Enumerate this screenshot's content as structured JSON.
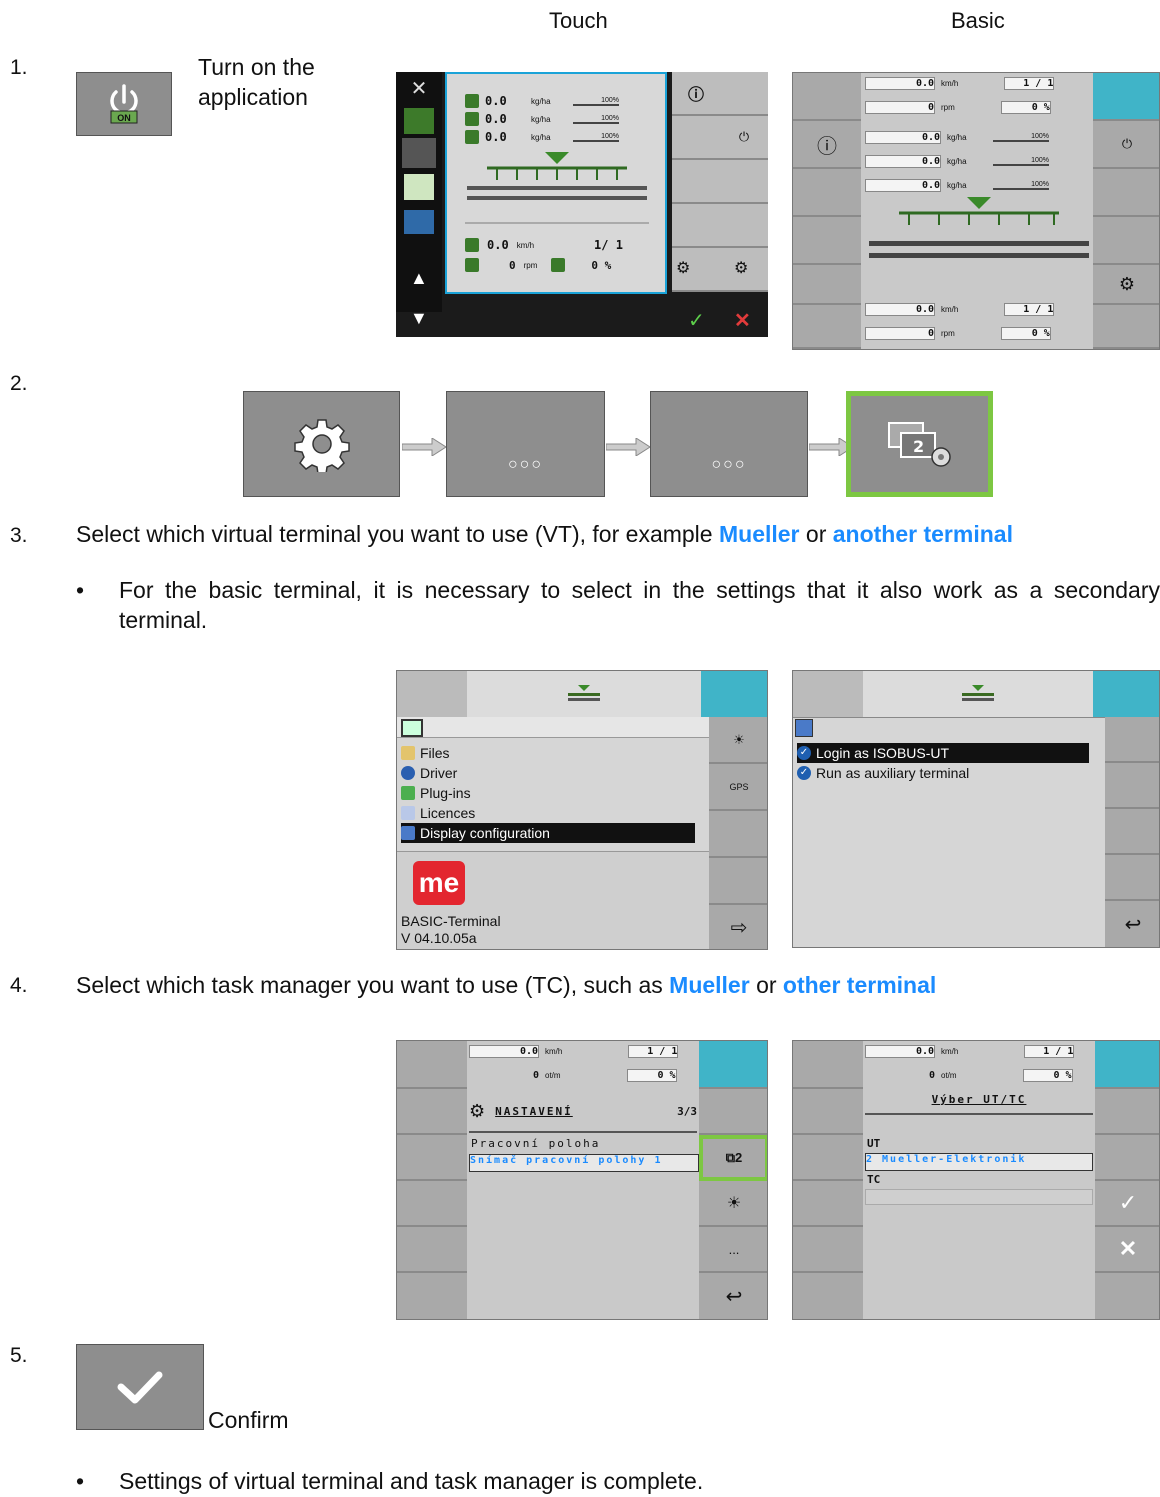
{
  "header": {
    "touch": "Touch",
    "basic": "Basic"
  },
  "steps": [
    {
      "num": "1.",
      "text": "Turn on the application",
      "button_label": "ON"
    },
    {
      "num": "2."
    },
    {
      "num": "3.",
      "text_before": "Select which virtual terminal you want to use (VT), for example ",
      "link1": "Mueller",
      "text_mid": " or ",
      "link2": "another terminal",
      "bullet": "For the basic terminal, it is necessary to select in the settings that it also work as a secondary terminal."
    },
    {
      "num": "4.",
      "text_before": "Select which task manager you want to use (TC), such as ",
      "link1": "Mueller",
      "text_mid": " or ",
      "link2": "other terminal"
    },
    {
      "num": "5.",
      "confirm": "Confirm",
      "bullet": "Settings of virtual terminal and task manager is complete."
    }
  ],
  "touch_screen": {
    "rates": [
      {
        "value": "0.0",
        "unit": "kg/ha",
        "pct": "100%"
      },
      {
        "value": "0.0",
        "unit": "kg/ha",
        "pct": "100%"
      },
      {
        "value": "0.0",
        "unit": "kg/ha",
        "pct": "100%"
      }
    ],
    "speed": "0.0",
    "speed_unit": "km/h",
    "section": "1/ 1",
    "rpm": "0",
    "rpm_unit": "rpm",
    "pct": "0 %"
  },
  "basic_screen": {
    "speed": "0.0",
    "speed_unit": "km/h",
    "section": "1 / 1",
    "rpm": "0",
    "rpm_unit": "rpm",
    "pct": "0 %",
    "rates": [
      {
        "value": "0.0",
        "unit": "kg/ha",
        "pct": "100%"
      },
      {
        "value": "0.0",
        "unit": "kg/ha",
        "pct": "100%"
      },
      {
        "value": "0.0",
        "unit": "kg/ha",
        "pct": "100%"
      }
    ]
  },
  "menu_screen": {
    "items": [
      "Files",
      "Driver",
      "Plug-ins",
      "Licences",
      "Display configuration"
    ],
    "logo": "me",
    "footer1": "BASIC-Terminal",
    "footer2": "V 04.10.05a"
  },
  "login_screen": {
    "items": [
      "Login as ISOBUS-UT",
      "Run as auxiliary terminal"
    ]
  },
  "settings_screen": {
    "speed": "0.0",
    "speed_unit": "km/h",
    "section": "1 / 1",
    "rpm": "0",
    "rpm_unit": "ot/m",
    "pct": "0 %",
    "title": "NASTAVENÍ",
    "page": "3/3",
    "label": "Pracovní poloha",
    "value": "Snímač pracovní polohy 1"
  },
  "select_screen": {
    "speed": "0.0",
    "speed_unit": "km/h",
    "section": "1 / 1",
    "rpm": "0",
    "rpm_unit": "ot/m",
    "pct": "0 %",
    "title": "Výber UT/TC",
    "ut_label": "UT",
    "ut_value": "2 Mueller-Elektronik",
    "tc_label": "TC"
  },
  "colors": {
    "blue_link": "#1a8bff",
    "green_highlight": "#7dc742",
    "grey_button": "#8e8e8e"
  },
  "icons": [
    "power-on-icon",
    "gear-icon",
    "ellipsis-icon",
    "display-config-icon",
    "checkmark-icon",
    "close-icon",
    "info-icon",
    "arrow-right-icon"
  ]
}
